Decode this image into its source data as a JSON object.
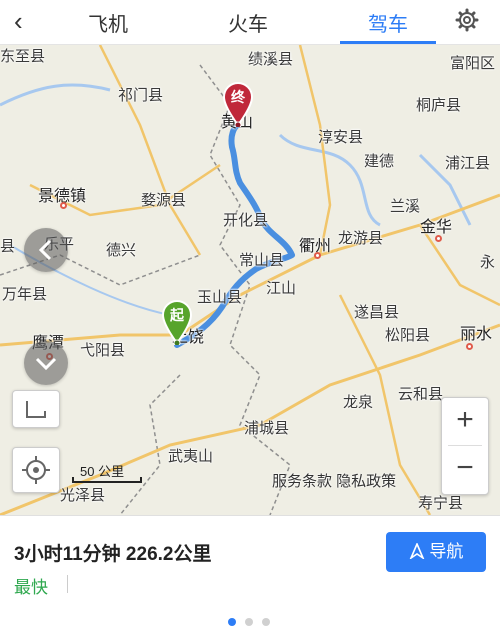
{
  "header": {
    "back_icon": "chevron-left-icon",
    "tabs": [
      {
        "label": "飞机",
        "active": false
      },
      {
        "label": "火车",
        "active": false
      },
      {
        "label": "驾车",
        "active": true
      }
    ],
    "settings_icon": "gear-icon",
    "accent_color": "#2d7df6"
  },
  "map": {
    "places": [
      {
        "name": "东至县"
      },
      {
        "name": "绩溪县"
      },
      {
        "name": "富阳区"
      },
      {
        "name": "祁门县"
      },
      {
        "name": "黄山"
      },
      {
        "name": "桐庐县"
      },
      {
        "name": "淳安县"
      },
      {
        "name": "建德"
      },
      {
        "name": "浦江县"
      },
      {
        "name": "景德镇"
      },
      {
        "name": "婺源县"
      },
      {
        "name": "兰溪"
      },
      {
        "name": "金华"
      },
      {
        "name": "乐平"
      },
      {
        "name": "德兴"
      },
      {
        "name": "开化县"
      },
      {
        "name": "衢州"
      },
      {
        "name": "龙游县"
      },
      {
        "name": "常山县"
      },
      {
        "name": "永"
      },
      {
        "name": "万年县"
      },
      {
        "name": "玉山县"
      },
      {
        "name": "江山"
      },
      {
        "name": "遂昌县"
      },
      {
        "name": "上饶"
      },
      {
        "name": "松阳县"
      },
      {
        "name": "丽水"
      },
      {
        "name": "鹰潭"
      },
      {
        "name": "弋阳县"
      },
      {
        "name": "龙泉"
      },
      {
        "name": "云和县"
      },
      {
        "name": "浦城县"
      },
      {
        "name": "武夷山"
      },
      {
        "name": "光泽县"
      },
      {
        "name": "寿宁县"
      },
      {
        "name": "县"
      }
    ],
    "start_marker": "起",
    "end_marker": "终",
    "scale_label": "50 公里",
    "zoom_in": "+",
    "zoom_out": "−",
    "footer_links": "服务条款 隐私政策",
    "route_color": "#4a8fe0"
  },
  "route": {
    "summary": "3小时11分钟  226.2公里",
    "tag": "最快",
    "navigate_label": "导航",
    "navigate_icon": "navigate-arrow-icon",
    "pages": 3,
    "active_page": 0
  }
}
